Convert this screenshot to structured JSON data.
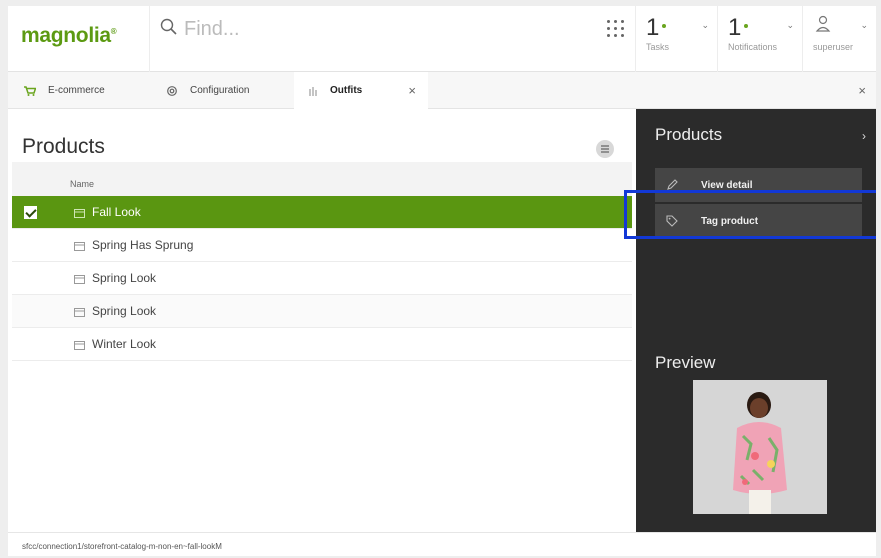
{
  "header": {
    "logo": "magnolia",
    "logo_mark": "®",
    "search_placeholder": "Find...",
    "tasks": {
      "count": "1",
      "label": "Tasks"
    },
    "notifications": {
      "count": "1",
      "label": "Notifications"
    },
    "user": {
      "label": "superuser"
    },
    "accent_color": "#5c9a12"
  },
  "tabs": [
    {
      "label": "E-commerce",
      "icon": "cart-icon"
    },
    {
      "label": "Configuration",
      "icon": "gear-icon"
    },
    {
      "label": "Outfits",
      "icon": "tags-icon",
      "active": true
    }
  ],
  "main": {
    "title": "Products",
    "column_name": "Name",
    "rows": [
      {
        "label": "Fall Look",
        "selected": true
      },
      {
        "label": "Spring Has Sprung"
      },
      {
        "label": "Spring Look"
      },
      {
        "label": "Spring Look"
      },
      {
        "label": "Winter Look"
      }
    ]
  },
  "actionbar": {
    "title": "Products",
    "actions": [
      {
        "label": "View detail",
        "icon": "pencil-icon"
      },
      {
        "label": "Tag product",
        "icon": "tag-icon"
      }
    ],
    "preview_title": "Preview"
  },
  "status": {
    "path": "sfcc/connection1/storefront-catalog-m-non-en~fall-lookM"
  }
}
